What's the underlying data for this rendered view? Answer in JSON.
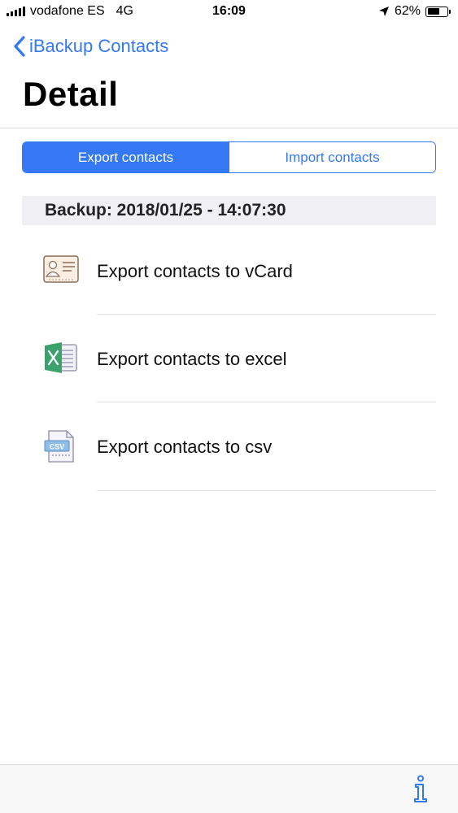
{
  "status_bar": {
    "carrier": "vodafone ES",
    "network": "4G",
    "time": "16:09",
    "battery_percent": "62%",
    "battery_level": 0.62,
    "location_icon": "location-arrow-icon"
  },
  "nav": {
    "back_label": "iBackup Contacts",
    "back_icon": "chevron-left-icon",
    "title": "Detail"
  },
  "segmented": {
    "export_label": "Export contacts",
    "import_label": "Import contacts",
    "selected": "export"
  },
  "backup": {
    "header": "Backup: 2018/01/25 - 14:07:30"
  },
  "export_options": [
    {
      "label": "Export contacts to vCard",
      "icon": "vcard-icon"
    },
    {
      "label": "Export contacts to excel",
      "icon": "excel-icon"
    },
    {
      "label": "Export contacts to csv",
      "icon": "csv-file-icon",
      "icon_text": "CSV"
    }
  ],
  "toolbar": {
    "info_icon": "info-icon"
  },
  "colors": {
    "accent": "#3478f6",
    "section_bg": "#efeff4",
    "excel_green": "#3aa36b"
  }
}
